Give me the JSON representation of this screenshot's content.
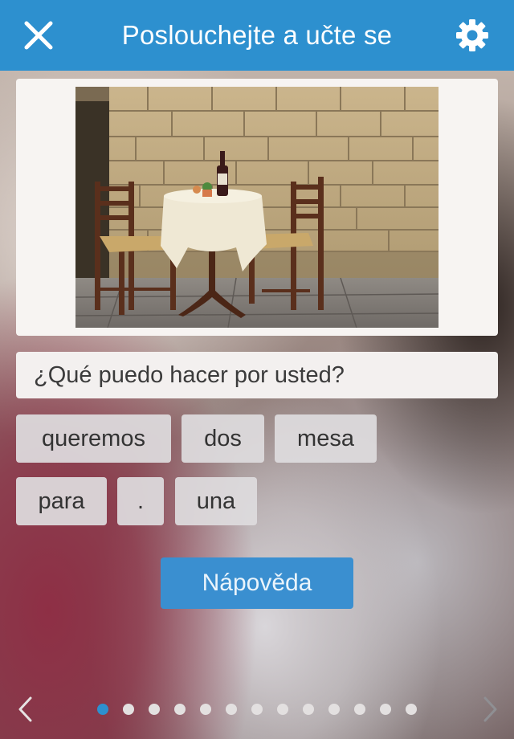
{
  "header": {
    "title": "Poslouchejte a učte se",
    "close_icon": "close-icon",
    "settings_icon": "gear-icon",
    "background_color": "#2d90cf"
  },
  "sentence": {
    "text": "¿Qué puedo hacer por usted?"
  },
  "word_chips": [
    {
      "label": "queremos"
    },
    {
      "label": "dos"
    },
    {
      "label": "mesa"
    },
    {
      "label": "para"
    },
    {
      "label": "."
    },
    {
      "label": "una"
    }
  ],
  "hint_button": {
    "label": "Nápověda",
    "color": "#3a8fd0"
  },
  "pagination": {
    "total_pages": 13,
    "current_page": 1,
    "prev_icon": "chevron-left-icon",
    "next_icon": "chevron-right-icon",
    "active_color": "#2d90cf"
  }
}
